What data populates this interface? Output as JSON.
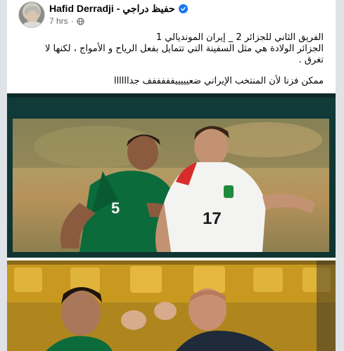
{
  "post": {
    "author": "Hafid Derradji - حفيظ دراجي",
    "timestamp": "7 hrs",
    "privacy_icon": "globe-icon",
    "text_lines": [
      "الفريق الثاني للجزائر 2 _ إيران المونديالي 1",
      "الجزائر الولادة هي مثل السفينة التي تتمايل بفعل الرياح و الأمواج ، لكنها لا",
      "تغرق .",
      "ممكن فزنا لأن المنتخب الإيراني ضعيييييفففففف جداااااا"
    ]
  },
  "media": {
    "top_image": {
      "subject": "Algeria player in green jersey number 5 and Iran player in white jersey number 17 contesting the ball",
      "jersey_left": "5",
      "jersey_right": "17"
    },
    "bottom_image": {
      "subject": "Algeria player embracing coach on the sideline"
    }
  },
  "colors": {
    "brand_blue": "#1877f2",
    "frame_green": "#103b38",
    "algeria_green": "#0c6b3b",
    "iran_white": "#f3f3f1"
  }
}
